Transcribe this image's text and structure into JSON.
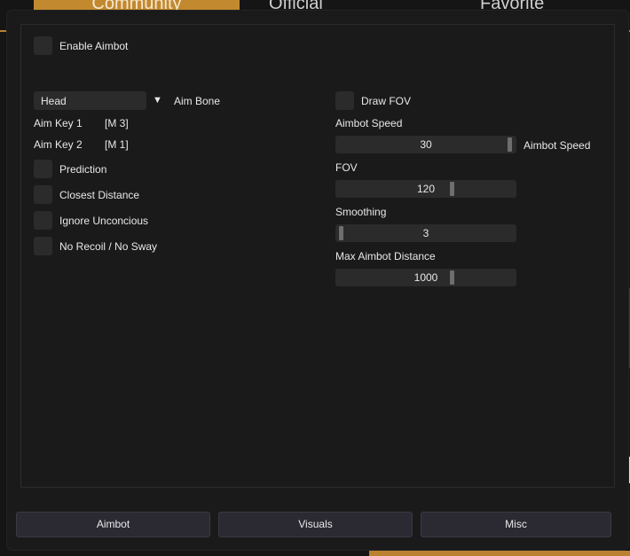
{
  "background": {
    "tabs": [
      "Community",
      "Official",
      "Favorite"
    ],
    "accent": "#b98130"
  },
  "aimbot": {
    "enable_label": "Enable Aimbot",
    "aim_bone": {
      "value": "Head",
      "label": "Aim Bone"
    },
    "aim_key_1": {
      "label": "Aim Key 1",
      "value": "[M 3]"
    },
    "aim_key_2": {
      "label": "Aim Key 2",
      "value": "[M 1]"
    },
    "options": [
      "Prediction",
      "Closest Distance",
      "Ignore Unconcious",
      "No Recoil / No Sway"
    ],
    "draw_fov_label": "Draw FOV",
    "aimbot_speed": {
      "heading": "Aimbot Speed",
      "value": "30",
      "side_label": "Aimbot Speed",
      "fraction": 1.0
    },
    "fov": {
      "heading": "FOV",
      "value": "120",
      "fraction": 0.66
    },
    "smoothing": {
      "heading": "Smoothing",
      "value": "3",
      "fraction": 0.0
    },
    "max_distance": {
      "heading": "Max Aimbot Distance",
      "value": "1000",
      "fraction": 0.66
    }
  },
  "nav": {
    "tabs": [
      "Aimbot",
      "Visuals",
      "Misc"
    ]
  }
}
